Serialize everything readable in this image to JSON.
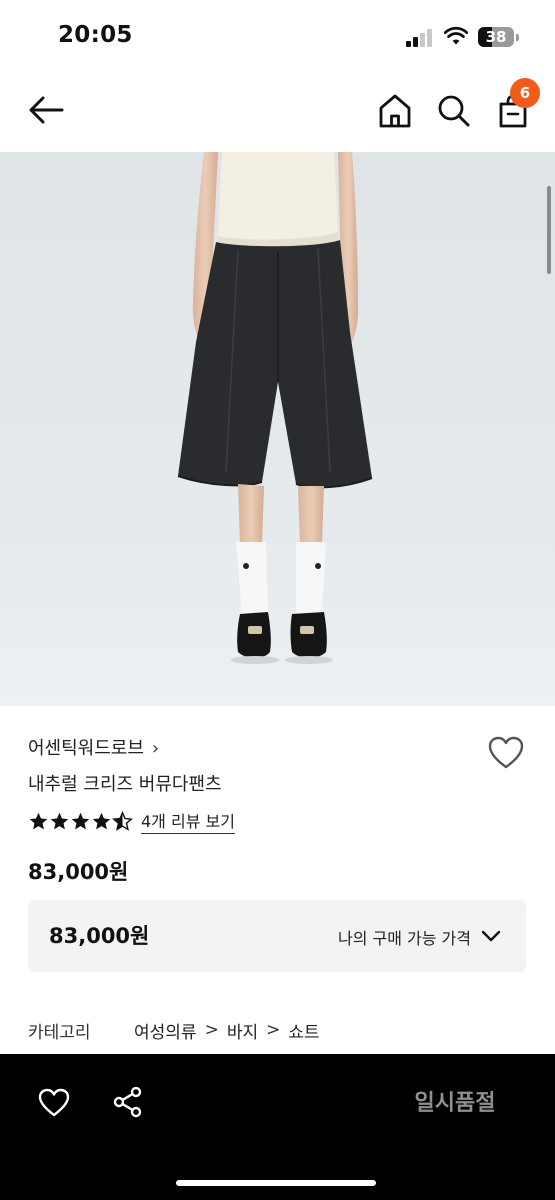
{
  "status_bar": {
    "time": "20:05",
    "battery": "38",
    "battery_level": 0.38
  },
  "header": {
    "cart_count": "6"
  },
  "product": {
    "brand": "어센틱워드로브",
    "brand_chevron": "›",
    "name": "내추럴 크리즈 버뮤다팬츠",
    "rating": 4.5,
    "review_link": "4개 리뷰 보기",
    "price": "83,000원"
  },
  "price_box": {
    "price": "83,000원",
    "label": "나의 구매 가능 가격"
  },
  "category": {
    "label": "카테고리",
    "path": [
      "여성의류",
      "바지",
      "쇼트"
    ],
    "separator": ">"
  },
  "bottom_bar": {
    "soldout_label": "일시품절"
  },
  "colors": {
    "accent": "#f15b1c",
    "bottom_bar": "#000000",
    "soldout_text": "#8f8f8f"
  },
  "icons": [
    "back-arrow-icon",
    "home-icon",
    "search-icon",
    "cart-icon",
    "heart-icon",
    "star-icon",
    "chevron-down-icon",
    "share-icon"
  ]
}
